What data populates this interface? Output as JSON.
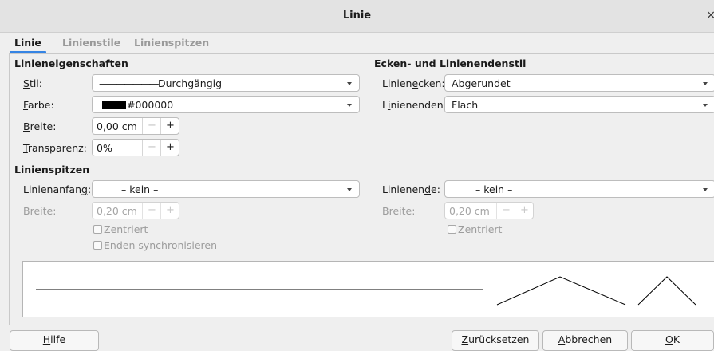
{
  "window": {
    "title": "Linie"
  },
  "tabs": [
    "Linie",
    "Linienstile",
    "Linienspitzen"
  ],
  "line_props": {
    "heading": "Linieneigenschaften",
    "stil": {
      "label_pre": "",
      "label_u": "S",
      "label_post": "til:",
      "line_sample": "———————",
      "value": "Durchgängig"
    },
    "farbe": {
      "label_u": "F",
      "label_post": "arbe:",
      "color": "#000000",
      "value": "#000000"
    },
    "breite": {
      "label_u": "B",
      "label_post": "reite:",
      "value": "0,00 cm"
    },
    "transparenz": {
      "label_u": "T",
      "label_post": "ransparenz:",
      "value": "0%"
    }
  },
  "corner_style": {
    "heading": "Ecken- und Linienendenstil",
    "ecken": {
      "label_pre": "Linien",
      "label_u": "e",
      "label_post": "cken:",
      "value": "Abgerundet"
    },
    "enden": {
      "label_pre": "L",
      "label_u": "i",
      "label_post": "nienenden:",
      "value": "Flach"
    }
  },
  "arrows": {
    "heading": "Linienspitzen",
    "anfang": {
      "label_pre": "Linienanfan",
      "label_u": "g",
      "label_post": ":",
      "value": "– kein –"
    },
    "ende": {
      "label_pre": "Linienen",
      "label_u": "d",
      "label_post": "e:",
      "value": "– kein –"
    },
    "breite_label": "Breite:",
    "breite_left": "0,20 cm",
    "breite_right": "0,20 cm",
    "zentriert": "Zentriert",
    "sync": "Enden synchronisieren"
  },
  "buttons": {
    "help": {
      "pre": "",
      "u": "H",
      "post": "ilfe"
    },
    "reset": {
      "pre": "",
      "u": "Z",
      "post": "urücksetzen"
    },
    "cancel": {
      "pre": "",
      "u": "A",
      "post": "bbrechen"
    },
    "ok": {
      "pre": "",
      "u": "O",
      "post": "K"
    }
  }
}
